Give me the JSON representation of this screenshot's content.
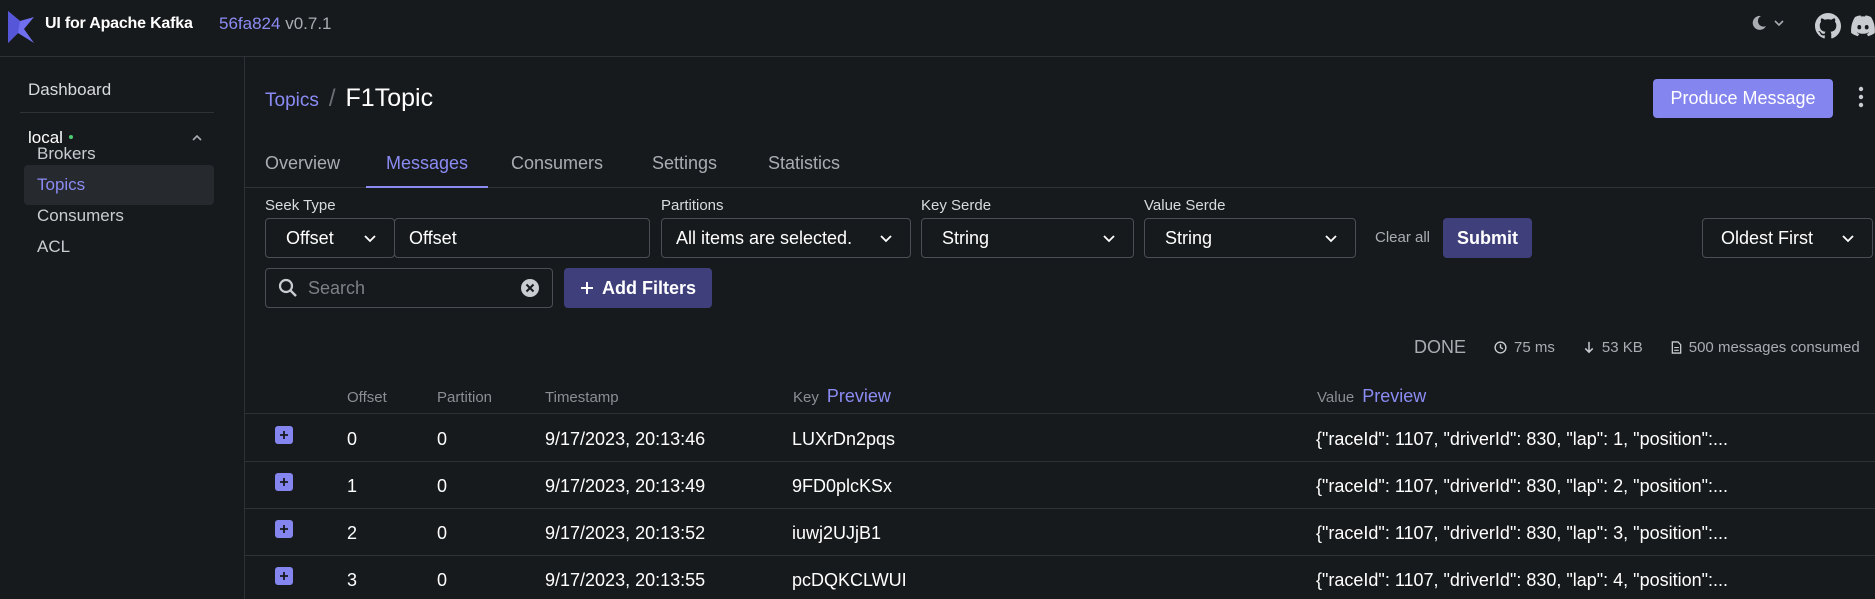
{
  "app": {
    "title": "UI for Apache Kafka",
    "version_hash": "56fa824",
    "version_tag": "v0.7.1"
  },
  "icons": {
    "logo": "kafka-ui-logo",
    "theme": "moon-icon",
    "github": "github-icon",
    "discord": "discord-icon"
  },
  "colors": {
    "accent": "#8b8bf4",
    "button": "#8585ef",
    "dark_button": "#3f3f7b",
    "online": "#4fce70"
  },
  "sidebar": {
    "dashboard": "Dashboard",
    "cluster": "local",
    "items": [
      {
        "label": "Brokers"
      },
      {
        "label": "Topics"
      },
      {
        "label": "Consumers"
      },
      {
        "label": "ACL"
      }
    ]
  },
  "header": {
    "breadcrumb_link": "Topics",
    "separator": "/",
    "current": "F1Topic",
    "produce_label": "Produce Message"
  },
  "tabs": [
    {
      "label": "Overview"
    },
    {
      "label": "Messages"
    },
    {
      "label": "Consumers"
    },
    {
      "label": "Settings"
    },
    {
      "label": "Statistics"
    }
  ],
  "filters": {
    "seek_type_label": "Seek Type",
    "seek_type_value": "Offset",
    "offset_value": "Offset",
    "partitions_label": "Partitions",
    "partitions_value": "All items are selected.",
    "key_serde_label": "Key Serde",
    "key_serde_value": "String",
    "value_serde_label": "Value Serde",
    "value_serde_value": "String",
    "clear_all": "Clear all",
    "submit": "Submit",
    "order_value": "Oldest First",
    "search_placeholder": "Search",
    "add_filters": "Add Filters"
  },
  "stats": {
    "status": "DONE",
    "elapsed": "75 ms",
    "bytes": "53 KB",
    "consumed": "500 messages consumed"
  },
  "table": {
    "columns": {
      "offset": "Offset",
      "partition": "Partition",
      "timestamp": "Timestamp",
      "key": "Key",
      "value": "Value",
      "preview": "Preview"
    },
    "rows": [
      {
        "offset": "0",
        "partition": "0",
        "timestamp": "9/17/2023, 20:13:46",
        "key": "LUXrDn2pqs",
        "value": "{\"raceId\": 1107, \"driverId\": 830, \"lap\": 1, \"position\":..."
      },
      {
        "offset": "1",
        "partition": "0",
        "timestamp": "9/17/2023, 20:13:49",
        "key": "9FD0plcKSx",
        "value": "{\"raceId\": 1107, \"driverId\": 830, \"lap\": 2, \"position\":..."
      },
      {
        "offset": "2",
        "partition": "0",
        "timestamp": "9/17/2023, 20:13:52",
        "key": "iuwj2UJjB1",
        "value": "{\"raceId\": 1107, \"driverId\": 830, \"lap\": 3, \"position\":..."
      },
      {
        "offset": "3",
        "partition": "0",
        "timestamp": "9/17/2023, 20:13:55",
        "key": "pcDQKCLWUI",
        "value": "{\"raceId\": 1107, \"driverId\": 830, \"lap\": 4, \"position\":..."
      }
    ]
  }
}
